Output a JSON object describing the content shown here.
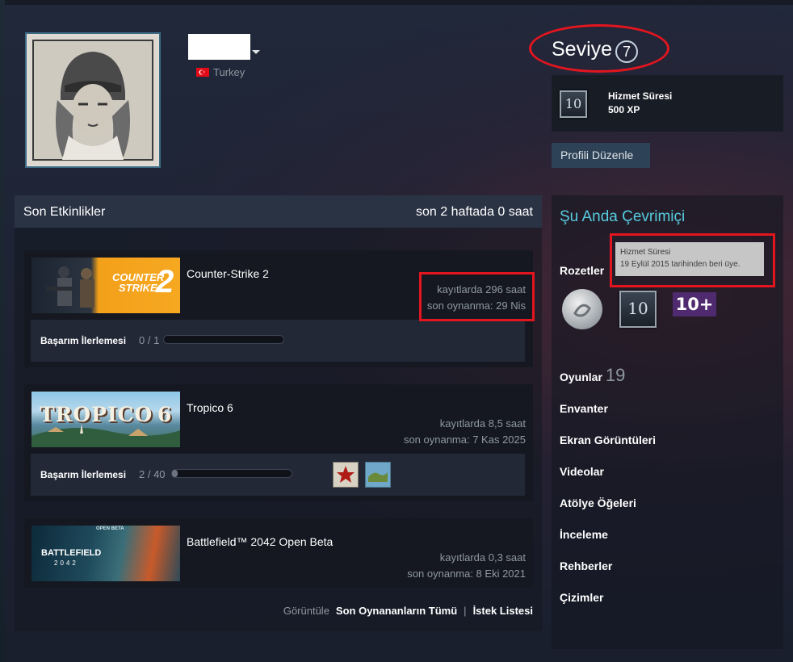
{
  "profile": {
    "country": "Turkey",
    "level_label": "Seviye",
    "level_value": "7",
    "edit_button": "Profili Düzenle"
  },
  "favorite_badge": {
    "icon_text": "10",
    "title": "Hizmet Süresi",
    "xp": "500 XP"
  },
  "activity": {
    "title": "Son Etkinlikler",
    "summary": "son 2 haftada 0 saat",
    "games": [
      {
        "name": "Counter-Strike 2",
        "hours": "kayıtlarda 296 saat",
        "last_played": "son oynanma: 29 Nis",
        "ach_label": "Başarım İlerlemesi",
        "ach_count": "0 / 1",
        "ach_progress": 0
      },
      {
        "name": "Tropico 6",
        "hours": "kayıtlarda 8,5 saat",
        "last_played": "son oynanma: 7 Kas 2025",
        "ach_label": "Başarım İlerlemesi",
        "ach_count": "2 / 40",
        "ach_progress": 0.05
      },
      {
        "name": "Battlefield™ 2042 Open Beta",
        "hours": "kayıtlarda 0,3 saat",
        "last_played": "son oynanma: 8 Eki 2021"
      }
    ],
    "footer": {
      "view_label": "Görüntüle",
      "all_recent": "Son Oynananların Tümü",
      "separator": "|",
      "wishlist": "İstek Listesi"
    }
  },
  "right": {
    "online_status": "Şu Anda Çevrimiçi",
    "badges_label": "Rozetler",
    "tooltip_title": "Hizmet Süresi",
    "tooltip_text": "19 Eylül 2015 tarihinden beri üye.",
    "badge_ten_text": "10",
    "badge_tenplus_text": "10+",
    "games_label": "Oyunlar",
    "games_count": "19",
    "links": [
      "Envanter",
      "Ekran Görüntüleri",
      "Videolar",
      "Atölye Öğeleri",
      "İnceleme",
      "Rehberler",
      "Çizimler"
    ]
  },
  "game_art": {
    "cs2_logo_line1": "COUNTER",
    "cs2_logo_line2": "STRIKE",
    "cs2_logo_num": "2",
    "tropico_logo": "TROPICO",
    "tropico_num": "6",
    "bf_tag": "OPEN BETA",
    "bf_logo": "BATTLEFIELD",
    "bf_year": "2042"
  },
  "colors": {
    "accent_online": "#57cbde",
    "highlight_red": "#e3151f",
    "button_bg": "#2e4257"
  }
}
